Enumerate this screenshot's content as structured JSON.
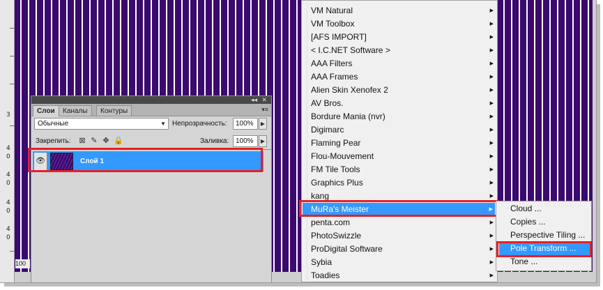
{
  "layers_panel": {
    "tabs": [
      "Слои",
      "Каналы",
      "Контуры"
    ],
    "blend_mode": "Обычные",
    "opacity_label": "Непрозрачность:",
    "opacity_value": "100%",
    "lock_label": "Закрепить:",
    "fill_label": "Заливка:",
    "fill_value": "100%",
    "layer_name": "Слой 1",
    "icons": [
      "collapse-icon",
      "close-icon",
      "panel-menu-icon",
      "eye-icon",
      "lock-transparency-icon",
      "lock-paint-icon",
      "lock-move-icon",
      "lock-all-icon"
    ]
  },
  "zoom": "100",
  "ruler": [
    "3",
    "4",
    "0",
    "4",
    "0",
    "4",
    "0",
    "4",
    "0"
  ],
  "menu": {
    "items": [
      "VM Natural",
      "VM Toolbox",
      "[AFS IMPORT]",
      "< I.C.NET Software >",
      "AAA Filters",
      "AAA Frames",
      "Alien Skin Xenofex 2",
      "AV Bros.",
      "Bordure Mania (nvr)",
      "Digimarc",
      "Flaming Pear",
      "Flou-Mouvement",
      "FM Tile Tools",
      "Graphics Plus",
      "kang",
      "MuRa's Meister",
      "penta.com",
      "PhotoSwizzle",
      "ProDigital Software",
      "Sybia",
      "Toadies"
    ],
    "selected": "MuRa's Meister"
  },
  "submenu": {
    "items": [
      "Cloud ...",
      "Copies ...",
      "Perspective Tiling ...",
      "Pole Transform ...",
      "Tone ..."
    ],
    "selected": "Pole Transform ..."
  },
  "colors": {
    "canvas_stripe": "#3b0a6e",
    "selection": "#3399ff",
    "highlight_box": "#e4202a",
    "menu_bg": "#f0f0f0"
  }
}
